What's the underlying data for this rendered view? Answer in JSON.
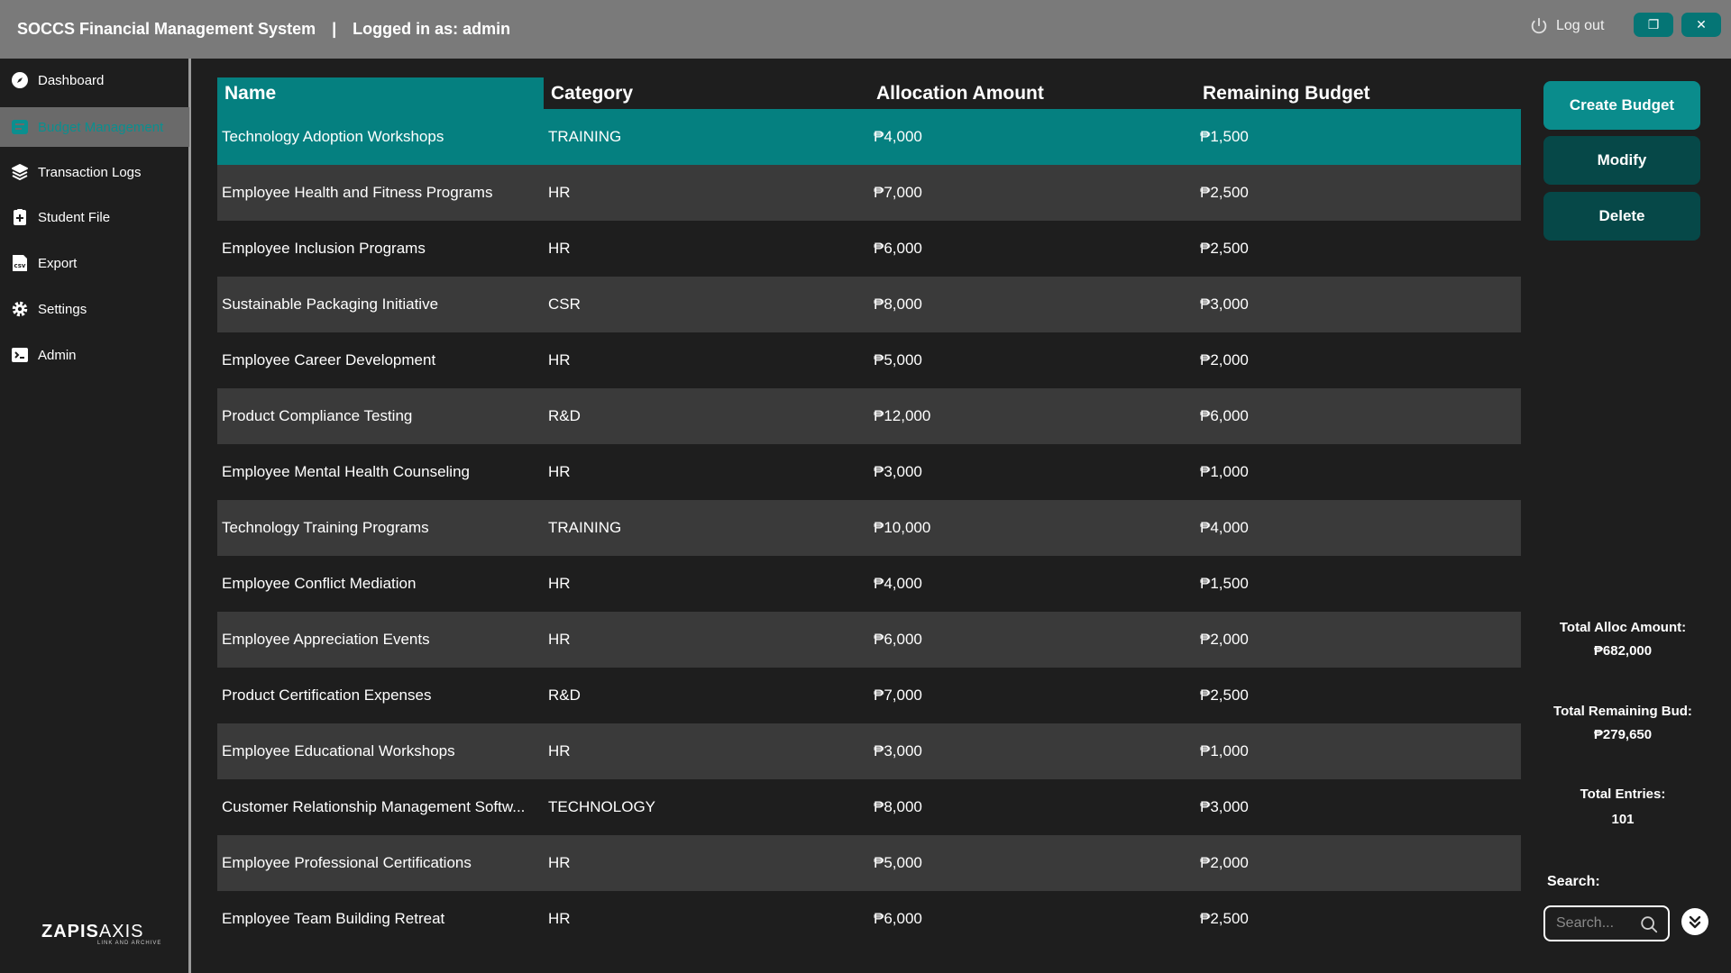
{
  "window": {
    "app_title": "SOCCS Financial Management System",
    "separator": "|",
    "user_label": "Logged in as: admin",
    "logout_label": "Log out"
  },
  "sidebar": {
    "items": [
      {
        "label": "Dashboard",
        "icon": "compass-icon"
      },
      {
        "label": "Budget Management",
        "icon": "budget-icon",
        "active": true
      },
      {
        "label": "Transaction Logs",
        "icon": "layers-icon"
      },
      {
        "label": "Student File",
        "icon": "clipboard-plus-icon"
      },
      {
        "label": "Export",
        "icon": "csv-file-icon"
      },
      {
        "label": "Settings",
        "icon": "gear-icon"
      },
      {
        "label": "Admin",
        "icon": "terminal-icon"
      }
    ],
    "brand": {
      "name_bold": "ZAPIS",
      "name_light": "AXIS",
      "tagline": "LINK AND ARCHIVE"
    }
  },
  "table": {
    "headers": [
      "Name",
      "Category",
      "Allocation Amount",
      "Remaining Budget"
    ],
    "rows": [
      [
        "Technology Adoption Workshops",
        "TRAINING",
        "₱4,000",
        "₱1,500"
      ],
      [
        "Employee Health and Fitness Programs",
        "HR",
        "₱7,000",
        "₱2,500"
      ],
      [
        "Employee Inclusion Programs",
        "HR",
        "₱6,000",
        "₱2,500"
      ],
      [
        "Sustainable Packaging Initiative",
        "CSR",
        "₱8,000",
        "₱3,000"
      ],
      [
        "Employee Career Development",
        "HR",
        "₱5,000",
        "₱2,000"
      ],
      [
        "Product Compliance Testing",
        "R&D",
        "₱12,000",
        "₱6,000"
      ],
      [
        "Employee Mental Health Counseling",
        "HR",
        "₱3,000",
        "₱1,000"
      ],
      [
        "Technology Training Programs",
        "TRAINING",
        "₱10,000",
        "₱4,000"
      ],
      [
        "Employee Conflict Mediation",
        "HR",
        "₱4,000",
        "₱1,500"
      ],
      [
        "Employee Appreciation Events",
        "HR",
        "₱6,000",
        "₱2,000"
      ],
      [
        "Product Certification Expenses",
        "R&D",
        "₱7,000",
        "₱2,500"
      ],
      [
        "Employee Educational Workshops",
        "HR",
        "₱3,000",
        "₱1,000"
      ],
      [
        "Customer Relationship Management Softw...",
        "TECHNOLOGY",
        "₱8,000",
        "₱3,000"
      ],
      [
        "Employee Professional Certifications",
        "HR",
        "₱5,000",
        "₱2,000"
      ],
      [
        "Employee Team Building Retreat",
        "HR",
        "₱6,000",
        "₱2,500"
      ]
    ],
    "selected_index": 0
  },
  "actions": {
    "create_label": "Create Budget",
    "modify_label": "Modify",
    "delete_label": "Delete"
  },
  "summary": {
    "total_alloc_label": "Total Alloc Amount:",
    "total_alloc_value": "₱682,000",
    "total_remaining_label": "Total Remaining Bud:",
    "total_remaining_value": "₱279,650",
    "total_entries_label": "Total Entries:",
    "total_entries_value": "101"
  },
  "search": {
    "label": "Search:",
    "placeholder": "Search..."
  },
  "colors": {
    "accent": "#058080",
    "accent_dark": "#064848",
    "titlebar": "#7a7a7a",
    "background": "#1e1e1e",
    "row_alt": "#3a3a3a"
  }
}
